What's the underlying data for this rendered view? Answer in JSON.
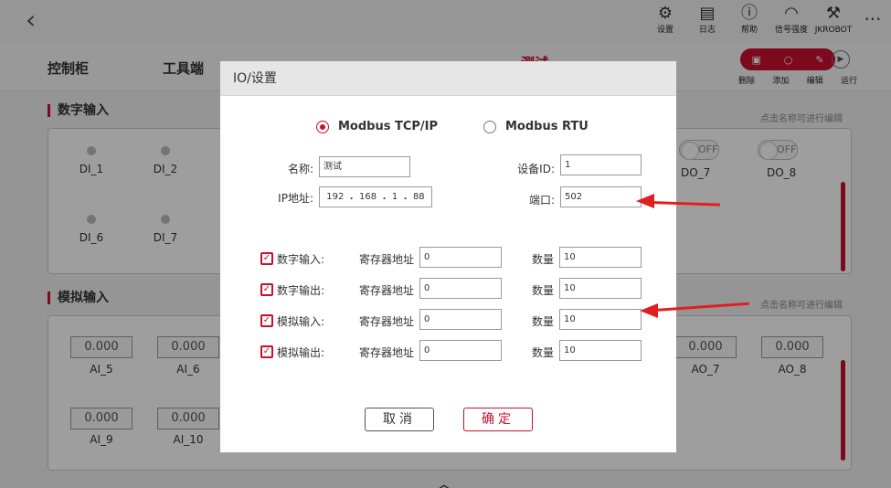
{
  "topbar": {
    "back_icon": "chevron-left-icon",
    "items": [
      {
        "icon": "gear-icon",
        "label": "设置"
      },
      {
        "icon": "log-icon",
        "label": "日志"
      },
      {
        "icon": "help-icon",
        "label": "帮助"
      },
      {
        "icon": "wifi-icon",
        "label": "信号强度"
      },
      {
        "icon": "robot-arm-icon",
        "label": "JKROBOT"
      }
    ],
    "more_icon": "more-icon"
  },
  "tabs": [
    {
      "label": "控制柜"
    },
    {
      "label": "工具端"
    },
    {
      "label": "测试"
    }
  ],
  "actions": {
    "labels": [
      "删除",
      "添加",
      "编辑",
      "运行"
    ]
  },
  "digital_input": {
    "title": "数字输入",
    "edit_hint": "点击名称可进行编辑",
    "inputs": [
      "DI_1",
      "DI_2",
      "DI_6",
      "DI_7"
    ],
    "outputs": [
      {
        "label": "DO_7",
        "state": "OFF"
      },
      {
        "label": "DO_8",
        "state": "OFF"
      }
    ]
  },
  "analog_input": {
    "title": "模拟输入",
    "edit_hint": "点击名称可进行编辑",
    "inputs": [
      {
        "label": "AI_5",
        "value": "0.000"
      },
      {
        "label": "AI_6",
        "value": "0.000"
      },
      {
        "label": "AI_9",
        "value": "0.000"
      },
      {
        "label": "AI_10",
        "value": "0.000"
      }
    ],
    "outputs": [
      {
        "label": "AO_7",
        "value": "0.000"
      },
      {
        "label": "AO_8",
        "value": "0.000"
      }
    ]
  },
  "dialog": {
    "title": "IO/设置",
    "protocols": [
      {
        "label": "Modbus TCP/IP",
        "selected": true
      },
      {
        "label": "Modbus RTU",
        "selected": false
      }
    ],
    "name_label": "名称:",
    "name_value": "测试",
    "device_id_label": "设备ID:",
    "device_id_value": "1",
    "ip_label": "IP地址:",
    "ip": [
      "192",
      "168",
      "1",
      "88"
    ],
    "ip_sep": ".",
    "port_label": "端口:",
    "port_value": "502",
    "reg_addr_label": "寄存器地址",
    "count_label": "数量",
    "rows": [
      {
        "label": "数字输入:",
        "checked": true,
        "address": "0",
        "count": "10"
      },
      {
        "label": "数字输出:",
        "checked": true,
        "address": "0",
        "count": "10"
      },
      {
        "label": "模拟输入:",
        "checked": true,
        "address": "0",
        "count": "10"
      },
      {
        "label": "模拟输出:",
        "checked": true,
        "address": "0",
        "count": "10"
      }
    ],
    "cancel_label": "取消",
    "ok_label": "确定"
  },
  "colors": {
    "accent": "#c8102e",
    "annotation_arrow": "#e02020"
  }
}
